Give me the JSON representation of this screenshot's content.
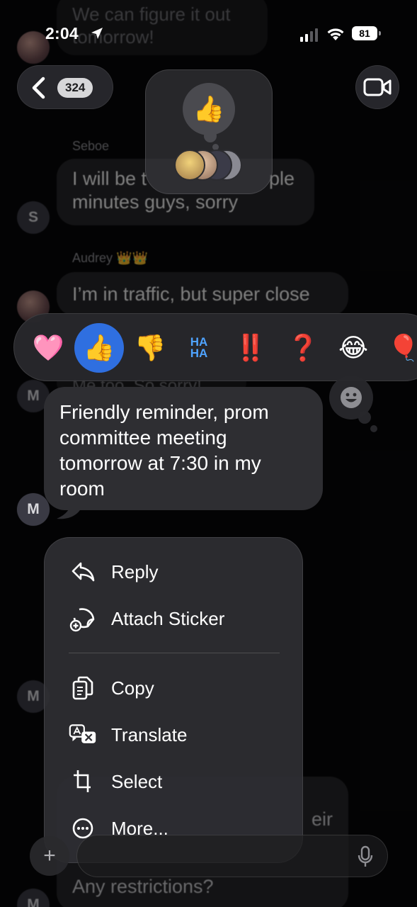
{
  "status_bar": {
    "time": "2:04",
    "battery": "81"
  },
  "header": {
    "unread_count": "324"
  },
  "background_messages": {
    "top_bubble_line1": "We can figure it out",
    "top_bubble_line2": "tomorrow!",
    "sender_seboe": "Seboe",
    "seboe_line1": "I will be t",
    "seboe_line1_end": "ple",
    "seboe_line2": "minutes guys, sorry",
    "avatar_s": "S",
    "sender_audrey": "Audrey 👑👑",
    "audrey_text": "I’m in traffic, but super close",
    "me_too": "Me too. So sorry!",
    "avatar_m": "M",
    "bottom_line1": "eir",
    "bottom_line2": "Any restrictions?"
  },
  "group_reactions": {
    "emoji": "👍"
  },
  "tapbacks": [
    {
      "name": "heart",
      "glyph": "🩷"
    },
    {
      "name": "thumbs-up",
      "glyph": "👍",
      "selected": true
    },
    {
      "name": "thumbs-down",
      "glyph": "👎"
    },
    {
      "name": "haha",
      "glyph": "HA\nHA"
    },
    {
      "name": "exclamation",
      "glyph": "‼️"
    },
    {
      "name": "question",
      "glyph": "❓"
    },
    {
      "name": "laugh",
      "glyph": "😂"
    },
    {
      "name": "balloon",
      "glyph": "🎈"
    }
  ],
  "focused_message": {
    "text": "Friendly reminder, prom committee meeting tomorrow at 7:30 in my room"
  },
  "context_menu": {
    "reply": "Reply",
    "attach_sticker": "Attach Sticker",
    "copy": "Copy",
    "translate": "Translate",
    "select": "Select",
    "more": "More..."
  },
  "compose": {
    "plus": "+"
  }
}
